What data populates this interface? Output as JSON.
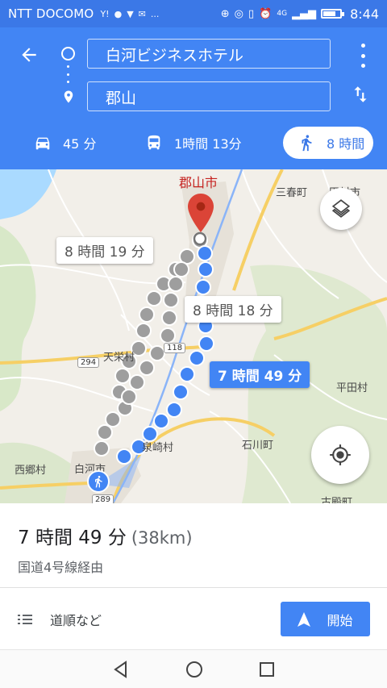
{
  "status_bar": {
    "carrier": "NTT DOCOMO",
    "notifications": [
      "Y!",
      "LINE",
      "twitter",
      "mail",
      "..."
    ],
    "network": "4G",
    "time": "8:44",
    "battery_level": 0.7
  },
  "header": {
    "origin": "白河ビジネスホテル",
    "destination": "郡山",
    "modes": [
      {
        "name": "car",
        "label": "45 分",
        "selected": false
      },
      {
        "name": "transit",
        "label": "1時間 13分",
        "selected": false
      },
      {
        "name": "walk",
        "label": "8 時間",
        "selected": true
      }
    ]
  },
  "map": {
    "labels": {
      "koriyama": "郡山市",
      "miharu": "三春町",
      "tamura": "田村市",
      "tenei": "天栄村",
      "hirata": "平田村",
      "izumizaki": "泉崎村",
      "ishikawa": "石川町",
      "nishigo": "西郷村",
      "shirakawa": "白河市",
      "furudono": "古殿町"
    },
    "road_shields": [
      "294",
      "118",
      "289"
    ],
    "routes": [
      {
        "label": "8 時間 19 分",
        "selected": false
      },
      {
        "label": "8 時間 18 分",
        "selected": false
      },
      {
        "label": "7 時間 49 分",
        "selected": true
      }
    ],
    "colors": {
      "selected_route": "#4285f4",
      "alt_route": "#9e9e9e",
      "pin": "#db4437"
    }
  },
  "summary": {
    "duration": "7 時間 49 分",
    "distance": "(38km)",
    "via": "国道4号線経由",
    "steps_label": "道順など",
    "start_label": "開始"
  }
}
